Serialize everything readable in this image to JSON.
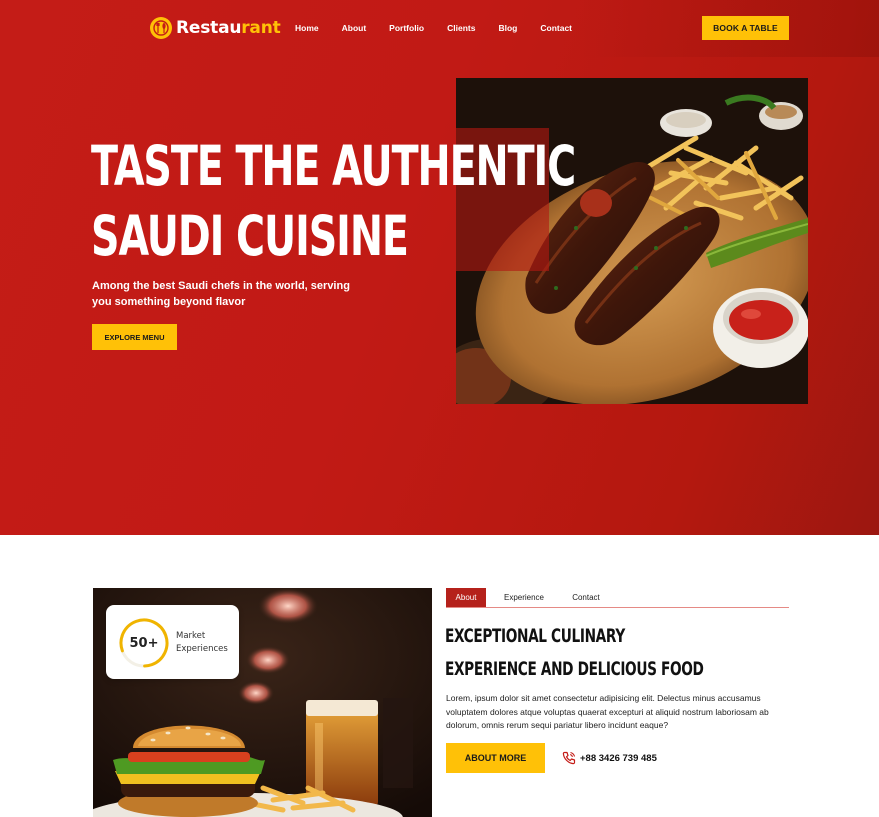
{
  "header": {
    "logo": {
      "text_main": "Restau",
      "text_accent": "rant"
    },
    "nav": [
      "Home",
      "About",
      "Portfolio",
      "Clients",
      "Blog",
      "Contact"
    ],
    "cta_label": "BOOK A TABLE"
  },
  "hero": {
    "title_line1": "TASTE THE AUTHENTIC",
    "title_line2": "SAUDI CUISINE",
    "subtitle": "Among the best Saudi chefs in the world, serving you something beyond flavor",
    "button_label": "EXPLORE MENU",
    "image": "grilled-meat-platter-photo"
  },
  "about": {
    "image": "burger-and-beer-photo",
    "stat": {
      "value": "50+",
      "label_line1": "Market",
      "label_line2": "Experiences",
      "ring_progress": 0.8
    },
    "tabs": [
      {
        "label": "About",
        "active": true
      },
      {
        "label": "Experience",
        "active": false
      },
      {
        "label": "Contact",
        "active": false
      }
    ],
    "title_line1": "EXCEPTIONAL CULINARY",
    "title_line2": "EXPERIENCE AND DELICIOUS FOOD",
    "body": "Lorem, ipsum dolor sit amet consectetur adipisicing elit. Delectus minus accusamus voluptatem dolores atque voluptas quaerat excepturi at aliquid nostrum laboriosam ab dolorum, omnis rerum sequi pariatur libero incidunt eaque?",
    "button_label": "ABOUT MORE",
    "phone": "+88 3426 739 485",
    "phone_icon": "phone-icon"
  },
  "colors": {
    "primary_red": "#c41c17",
    "accent_yellow": "#ffc107",
    "tab_active": "#b5211b",
    "text_dark": "#111111",
    "white": "#ffffff"
  }
}
